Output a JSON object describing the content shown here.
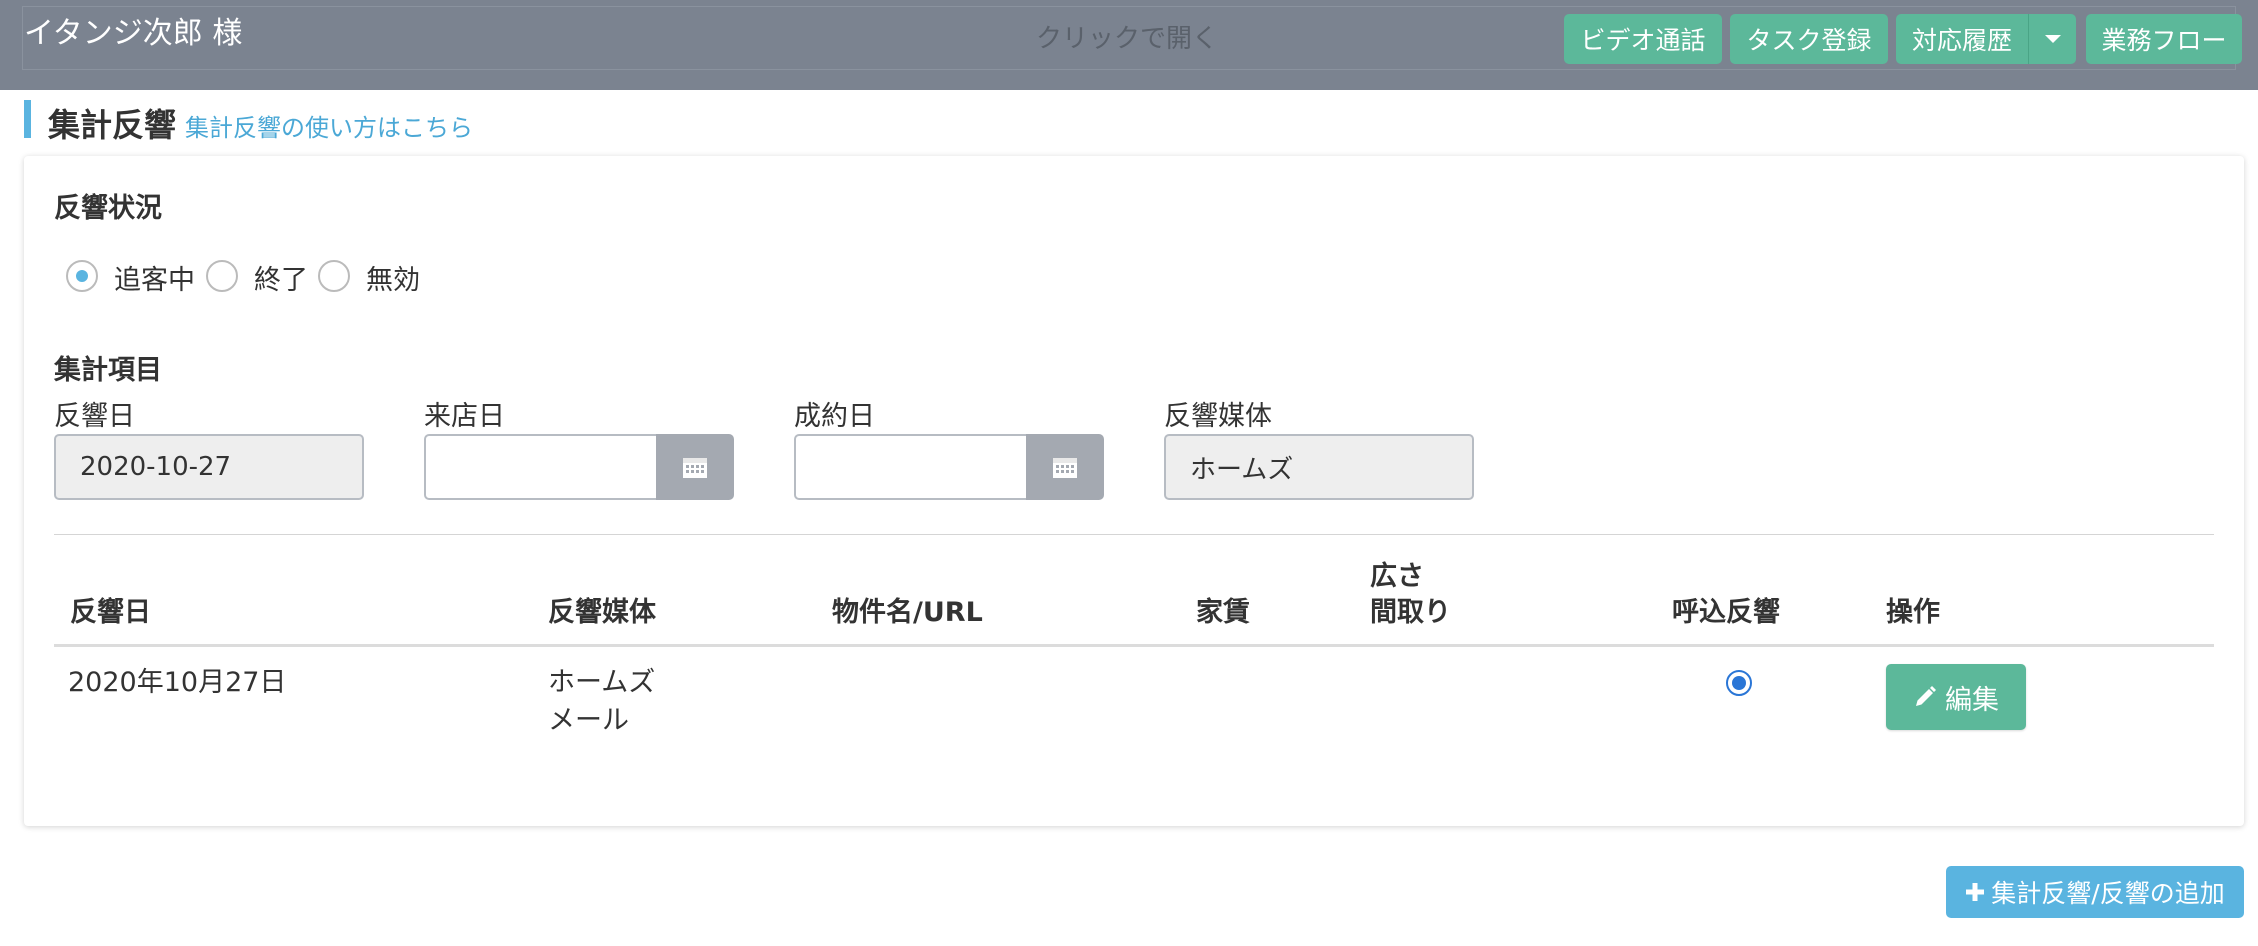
{
  "header": {
    "customer_name": "イタンジ次郎 様",
    "click_to_open": "クリックで開く",
    "buttons": {
      "video_call": "ビデオ通話",
      "task_register": "タスク登録",
      "history": "対応履歴",
      "workflow": "業務フロー"
    }
  },
  "section": {
    "title": "集計反響",
    "help_link": "集計反響の使い方はこちら"
  },
  "status": {
    "label": "反響状況",
    "options": [
      "追客中",
      "終了",
      "無効"
    ],
    "selected": "追客中"
  },
  "aggregate": {
    "label": "集計項目",
    "fields": {
      "response_date": {
        "label": "反響日",
        "value": "2020-10-27"
      },
      "visit_date": {
        "label": "来店日",
        "value": ""
      },
      "contract_date": {
        "label": "成約日",
        "value": ""
      },
      "media": {
        "label": "反響媒体",
        "value": "ホームズ"
      }
    }
  },
  "table": {
    "headers": {
      "date": "反響日",
      "media": "反響媒体",
      "property": "物件名/URL",
      "rent": "家賃",
      "area_line1": "広さ",
      "area_line2": "間取り",
      "included": "呼込反響",
      "action": "操作"
    },
    "rows": [
      {
        "date": "2020年10月27日",
        "media_line1": "ホームズ",
        "media_line2": "メール",
        "property": "",
        "rent": "",
        "area": "",
        "included": true,
        "edit_label": "編集"
      }
    ]
  },
  "add_button": "集計反響/反響の追加",
  "colors": {
    "header_bg": "#7b8390",
    "green": "#5cb89a",
    "blue": "#5ab4e0",
    "radio_blue": "#2a76d6"
  },
  "icons": [
    "calendar-icon",
    "pencil-icon",
    "plus-icon",
    "caret-down-icon"
  ]
}
